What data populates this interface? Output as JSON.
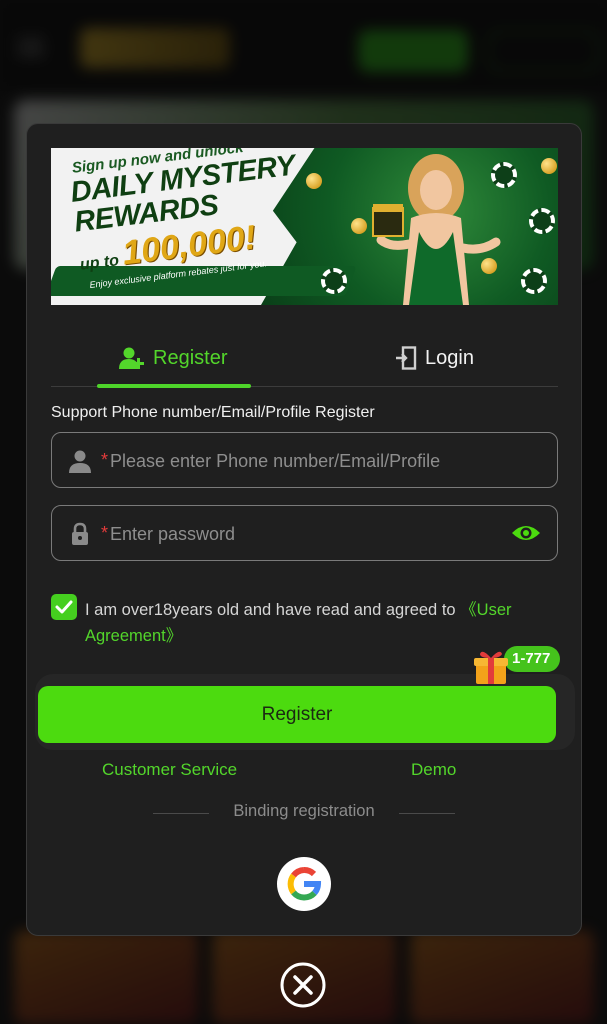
{
  "banner": {
    "line1": "Sign up now and unlock",
    "line2a": "DAILY MYSTERY",
    "line2b": "REWARDS",
    "line3_prefix": "up to",
    "line3_amount": "100,000!",
    "line4": "Enjoy exclusive platform rebates just for you."
  },
  "tabs": {
    "register": "Register",
    "login": "Login"
  },
  "form": {
    "support_label": "Support Phone number/Email/Profile Register",
    "required_mark": "*",
    "phone_placeholder": "Please enter Phone number/Email/Profile",
    "password_placeholder": "Enter password",
    "agreement_text": "I am over18years old and have read and agreed to ",
    "agreement_link": "《User Agreement》",
    "agreement_checked": true
  },
  "register_button": {
    "label": "Register",
    "badge": "1-777"
  },
  "links": {
    "customer_service": "Customer Service",
    "demo": "Demo"
  },
  "binding": {
    "label": "Binding registration"
  },
  "colors": {
    "accent_green": "#4cdb0f",
    "text_green": "#53d62b",
    "modal_bg": "#1f1f1f",
    "required_red": "#e23b3b"
  },
  "icons": {
    "register_tab": "user-plus-icon",
    "login_tab": "login-door-icon",
    "phone_field": "user-icon",
    "password_field": "lock-icon",
    "password_toggle": "eye-icon",
    "badge": "gift-icon",
    "social": "google-icon",
    "close": "close-circle-icon"
  }
}
